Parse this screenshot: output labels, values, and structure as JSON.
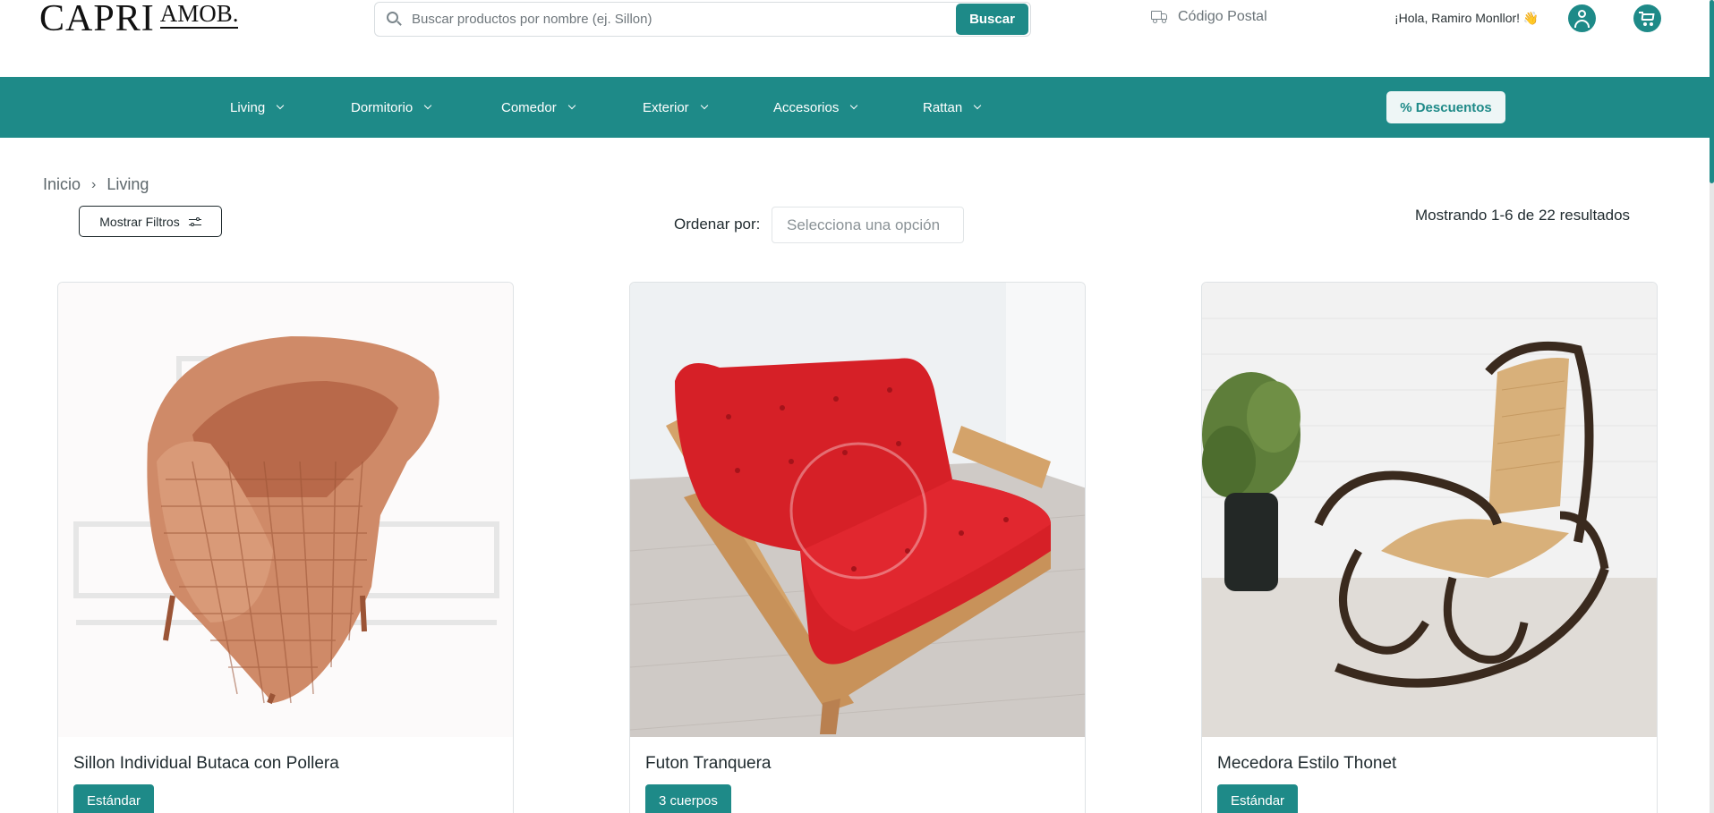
{
  "brand": {
    "name": "CAPRI",
    "sub": "AMOB."
  },
  "search": {
    "placeholder": "Buscar productos por nombre (ej. Sillon)",
    "button_label": "Buscar"
  },
  "postal": {
    "label": "Código Postal",
    "icon": "truck-icon"
  },
  "user": {
    "greeting": "¡Hola, Ramiro Monllor! 👋"
  },
  "nav": {
    "items": [
      {
        "label": "Living"
      },
      {
        "label": "Dormitorio"
      },
      {
        "label": "Comedor"
      },
      {
        "label": "Exterior"
      },
      {
        "label": "Accesorios"
      },
      {
        "label": "Rattan"
      }
    ],
    "discount_label": "% Descuentos"
  },
  "breadcrumb": {
    "home": "Inicio",
    "separator": "›",
    "current": "Living"
  },
  "toolbar": {
    "filters_label": "Mostrar Filtros",
    "sort_label": "Ordenar por:",
    "sort_placeholder": "Selecciona una opción",
    "results_text": "Mostrando 1-6 de 22 resultados"
  },
  "products": [
    {
      "title": "Sillon Individual Butaca con Pollera",
      "tag": "Estándar"
    },
    {
      "title": "Futon Tranquera",
      "tag": "3 cuerpos"
    },
    {
      "title": "Mecedora Estilo Thonet",
      "tag": "Estándar"
    }
  ],
  "colors": {
    "accent": "#1e8a88",
    "text": "#1f2a2e"
  }
}
